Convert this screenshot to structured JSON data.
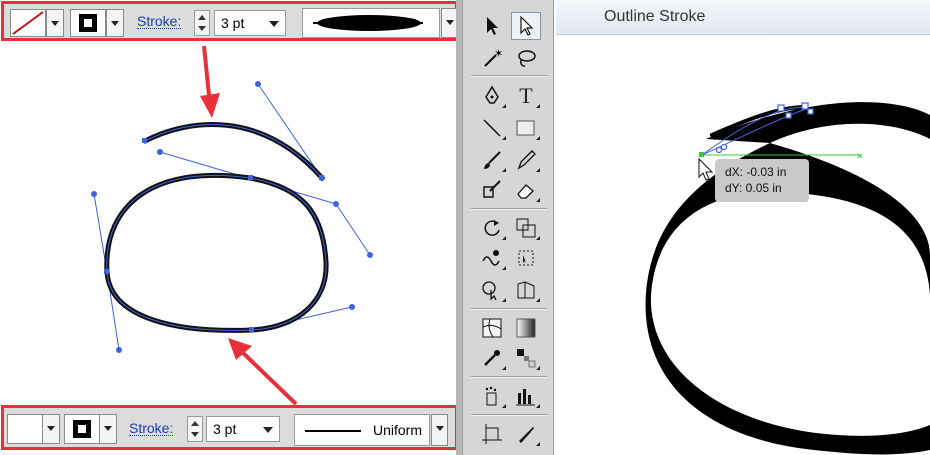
{
  "top_bar": {
    "fill_swatch": "none",
    "stroke_swatch": "black",
    "stroke_label": "Stroke:",
    "stroke_weight": "3 pt",
    "profile": "width-profile"
  },
  "bottom_bar": {
    "fill_swatch": "white",
    "stroke_swatch": "black",
    "stroke_label": "Stroke:",
    "stroke_weight": "3 pt",
    "profile_label": "Uniform"
  },
  "toolbox": {
    "tools": [
      "selection-tool",
      "direct-selection-tool",
      "magic-wand-tool",
      "lasso-tool",
      "pen-tool",
      "type-tool",
      "line-segment-tool",
      "rectangle-tool",
      "paintbrush-tool",
      "pencil-tool",
      "blob-brush-tool",
      "eraser-tool",
      "rotate-tool",
      "scale-tool",
      "warp-tool",
      "free-transform-tool",
      "shape-builder-tool",
      "perspective-grid-tool",
      "mesh-tool",
      "gradient-tool",
      "eyedropper-tool",
      "blend-tool",
      "symbol-sprayer-tool",
      "column-graph-tool",
      "artboard-tool",
      "slice-tool"
    ]
  },
  "right_panel": {
    "title": "Outline Stroke",
    "tooltip": {
      "dx": "dX: -0.03 in",
      "dy": "dY: 0.05 in"
    }
  },
  "colors": {
    "highlight": "#e8303a",
    "path_selection": "#3d63e0",
    "guide": "#33cc33",
    "toolbar_bg": "#dcdcdc"
  }
}
